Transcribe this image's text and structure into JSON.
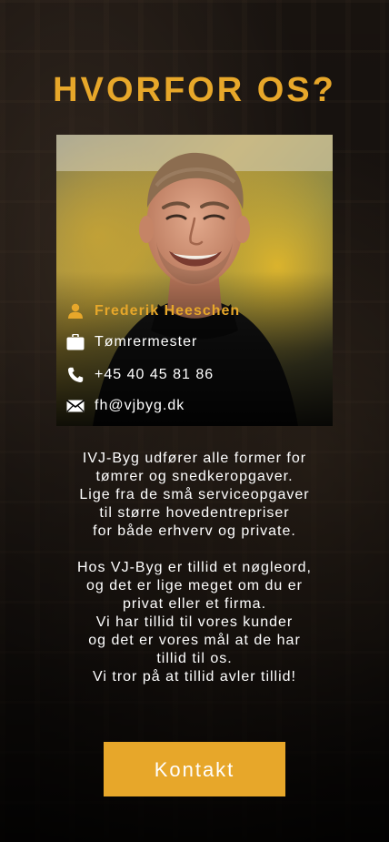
{
  "page": {
    "title": "HVORFOR OS?"
  },
  "contact_card": {
    "name": "Frederik Heeschen",
    "role": "Tømrermester",
    "phone": "+45 40 45 81 86",
    "email": "fh@vjbyg.dk"
  },
  "about": {
    "paragraph1": [
      "IVJ-Byg udfører alle former for",
      "tømrer og snedkeropgaver.",
      "Lige fra de små serviceopgaver",
      "til større hovedentrepriser",
      "for både erhverv og private."
    ],
    "paragraph2": [
      "Hos VJ-Byg er tillid et nøgleord,",
      "og det er lige meget om du er",
      "privat eller et firma.",
      "Vi har tillid til vores kunder",
      "og det er vores mål at de har",
      "tillid til os.",
      "Vi tror på at tillid avler tillid!"
    ]
  },
  "cta": {
    "label": "Kontakt"
  },
  "colors": {
    "accent": "#e7a72a",
    "text": "#ffffff",
    "card_bg": "#000000"
  },
  "icons": {
    "name": "user-icon",
    "role": "briefcase-icon",
    "phone": "phone-icon",
    "email": "envelope-icon"
  }
}
